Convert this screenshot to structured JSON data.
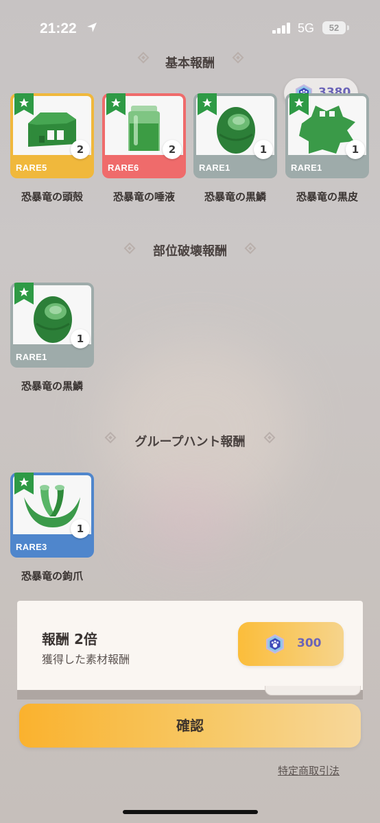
{
  "status_bar": {
    "time": "21:22",
    "network": "5G",
    "battery": "52"
  },
  "currency": {
    "icon": "paw-gem-icon",
    "amount": "3380"
  },
  "sections": {
    "basic": {
      "title": "基本報酬"
    },
    "part_break": {
      "title": "部位破壊報酬"
    },
    "group_hunt": {
      "title": "グループハント報酬"
    }
  },
  "basic_items": [
    {
      "name": "恐暴竜の頭殻",
      "rarity": "RARE5",
      "count": "2",
      "color": "#f0b83c",
      "icon": "skull-shell-icon"
    },
    {
      "name": "恐暴竜の唾液",
      "rarity": "RARE6",
      "count": "2",
      "color": "#ef6b6b",
      "icon": "saliva-jar-icon"
    },
    {
      "name": "恐暴竜の黒鱗",
      "rarity": "RARE1",
      "count": "1",
      "color": "#9eabaa",
      "icon": "black-scale-icon"
    },
    {
      "name": "恐暴竜の黒皮",
      "rarity": "RARE1",
      "count": "1",
      "color": "#9eabaa",
      "icon": "black-hide-icon"
    }
  ],
  "part_break_items": [
    {
      "name": "恐暴竜の黒鱗",
      "rarity": "RARE1",
      "count": "1",
      "color": "#9eabaa",
      "icon": "black-scale-icon"
    }
  ],
  "group_hunt_items": [
    {
      "name": "恐暴竜の鉤爪",
      "rarity": "RARE3",
      "count": "1",
      "color": "#4f86cc",
      "icon": "claw-icon"
    }
  ],
  "reward_panel": {
    "title": "報酬 2倍",
    "subtitle": "獲得した素材報酬",
    "price": "300",
    "price_icon": "paw-gem-icon"
  },
  "confirm_label": "確認",
  "law_link": "特定商取引法"
}
